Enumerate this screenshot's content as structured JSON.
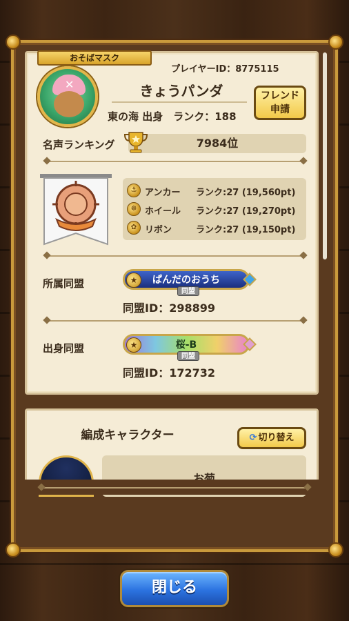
{
  "profile": {
    "mask_tag": "おそばマスク",
    "player_id": "プレイヤーID：8775115",
    "name": "きょうパンダ",
    "origin": "東の海 出身　ランク：188",
    "friend_button": "フレンド\n申請",
    "fame_label": "名声ランキング",
    "fame_rank": "7984位"
  },
  "stats": [
    {
      "icon": "anchor-icon",
      "name": "アンカー",
      "rank": "ランク:27 (19,560pt)"
    },
    {
      "icon": "wheel-icon",
      "name": "ホイール",
      "rank": "ランク:27 (19,270pt)"
    },
    {
      "icon": "ribbon-icon",
      "name": "リボン",
      "rank": "ランク:27 (19,150pt)"
    }
  ],
  "alliance": {
    "member_label": "所属同盟",
    "member_name": "ぱんだのおうち",
    "member_sub": "同盟",
    "member_id": "同盟ID：298899",
    "origin_label": "出身同盟",
    "origin_name": "桜-B",
    "origin_sub": "同盟",
    "origin_id": "同盟ID：172732"
  },
  "formation": {
    "title": "編成キャラクター",
    "switch_button": "切り替え",
    "character_name": "お菊"
  },
  "close_button": "閉じる",
  "colors": {
    "parchment": "#f5ecd6",
    "gold": "#c99a3c",
    "close_blue": "#2c73e0"
  }
}
